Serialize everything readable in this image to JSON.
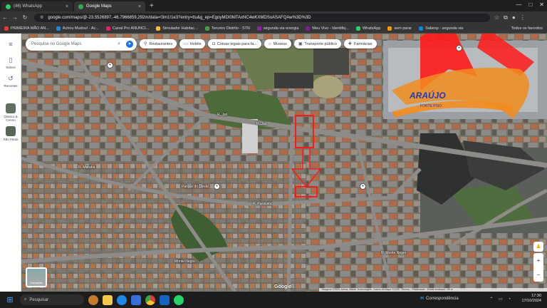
{
  "tabs": [
    {
      "label": "(46) WhatsApp",
      "color": "#25d366",
      "active": false
    },
    {
      "label": "Google Maps",
      "color": "#34a853",
      "active": true
    }
  ],
  "url": "google.com/maps/@-23.5526897,-46.7966859,292m/data=!3m1!1e3?entry=ttu&g_ep=EgoyMDI0MTAxNC4wKXMDSoASAFQAw%3D%3D",
  "bookmarks": [
    {
      "label": "PRIMEIRA MÃO AN...",
      "color": "#e53935"
    },
    {
      "label": "Achou Mudou! - Ac...",
      "color": "#1e88e5"
    },
    {
      "label": "Canal Pro ANUNCI...",
      "color": "#e91e63"
    },
    {
      "label": "Simulador Habitac...",
      "color": "#fbc02d"
    },
    {
      "label": "Terceiro Distrito - STN",
      "color": "#43a047"
    },
    {
      "label": "segunda via energia",
      "color": "#8e24aa"
    },
    {
      "label": "Meu Vivo - Identifiq...",
      "color": "#7b1fa2"
    },
    {
      "label": "WhatsApp",
      "color": "#25d366"
    },
    {
      "label": "sem parar",
      "color": "#ff9800"
    },
    {
      "label": "Sabesp - segunda via",
      "color": "#0288d1"
    }
  ],
  "bookmarks_all": "Todos os favoritos",
  "sidebar": [
    {
      "label": "Salvos",
      "icon": "bookmark-icon",
      "glyph": "▯"
    },
    {
      "label": "Recentes",
      "icon": "history-icon",
      "glyph": "↺"
    },
    {
      "label": "Osasco & Centro",
      "icon": "place-thumb"
    },
    {
      "label": "São Paulo",
      "icon": "place-thumb"
    }
  ],
  "search_placeholder": "Pesquise no Google Maps",
  "chips": [
    {
      "label": "Restaurantes",
      "icon": "restaurant-icon",
      "glyph": "🍴"
    },
    {
      "label": "Hotéis",
      "icon": "hotel-icon",
      "glyph": "🛏"
    },
    {
      "label": "Coisas legais para fa...",
      "icon": "camera-icon",
      "glyph": "📷"
    },
    {
      "label": "Museus",
      "icon": "museum-icon",
      "glyph": "🏛"
    },
    {
      "label": "Transporte público",
      "icon": "transit-icon",
      "glyph": "🚌"
    },
    {
      "label": "Farmácias",
      "icon": "pharmacy-icon",
      "glyph": "✚"
    }
  ],
  "street_labels": [
    {
      "text": "R. Jaú",
      "name": "street-label-jau"
    },
    {
      "text": "R. Jaú",
      "name": "street-label-jau-2"
    },
    {
      "text": "Parque do Oeste",
      "name": "poi-label-parque"
    },
    {
      "text": "R. Paracatu",
      "name": "street-label-paracatu"
    },
    {
      "text": "R. Monte Negro",
      "name": "street-label-monte-negro"
    },
    {
      "text": "Monte Negro",
      "name": "street-label-monte-negro-2"
    },
    {
      "text": "R. Marabá",
      "name": "street-label-maraba"
    },
    {
      "text": "ARAÚJO",
      "name": "overlay-brand-text"
    },
    {
      "text": "FORTE PISO",
      "name": "overlay-brand-sub"
    }
  ],
  "layers_label": "Camadas",
  "google_logo": "Google",
  "attribution": "Imagens ©2024, Airbus, Maxar Technologies · Dados do mapa ©2024 · Termos · Privacidade · Enviar feedback · 20 m",
  "taskbar": {
    "search_label": "Pesquisar",
    "weather": "Correspondência",
    "time": "17:30",
    "date": "17/10/2024"
  },
  "colors": {
    "accent": "#1a73e8",
    "overlay_red": "#ff1a1a",
    "overlay_orange": "#f28c1e",
    "overlay_blue": "#1f3bb8"
  }
}
